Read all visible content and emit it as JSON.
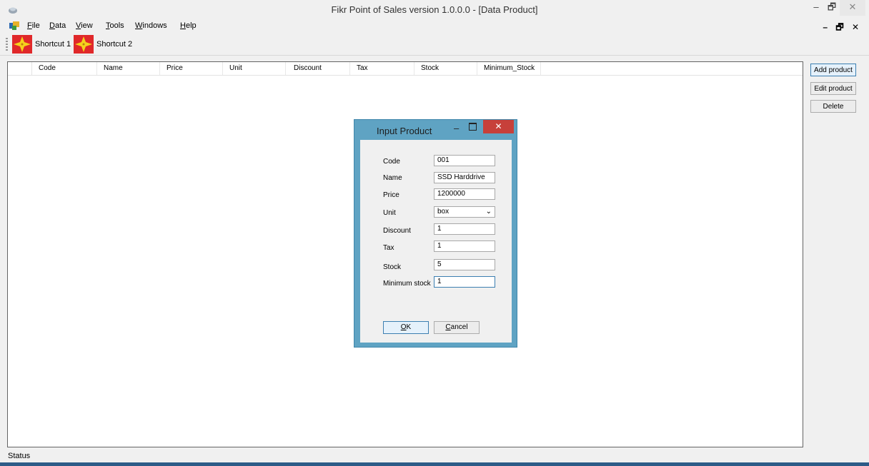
{
  "window": {
    "title": "Fikr Point of Sales version 1.0.0.0 - [Data Product]",
    "app_icon": "app-icon",
    "min": "–",
    "max": "🗗",
    "close": "✕"
  },
  "menu": {
    "items": [
      {
        "hot": "F",
        "rest": "ile"
      },
      {
        "hot": "D",
        "rest": "ata"
      },
      {
        "hot": "V",
        "rest": "iew"
      },
      {
        "hot": "T",
        "rest": "ools"
      },
      {
        "hot": "W",
        "rest": "indows"
      },
      {
        "hot": "H",
        "rest": "elp"
      }
    ],
    "mdi_controls": "– 🗗 ✕"
  },
  "toolbar": {
    "shortcut1": "Shortcut 1",
    "shortcut2": "Shortcut 2",
    "icon_color": "#e0282a"
  },
  "grid": {
    "columns": [
      "Code",
      "Name",
      "Price",
      "Unit",
      "Discount",
      "Tax",
      "Stock",
      "Minimum_Stock"
    ]
  },
  "side_buttons": {
    "add": "Add product",
    "edit": "Edit product",
    "delete": "Delete"
  },
  "status": {
    "text": "Status"
  },
  "dialog": {
    "title": "Input Product",
    "min": "–",
    "close": "✕",
    "fields": {
      "code": {
        "label": "Code",
        "value": "001"
      },
      "name": {
        "label": "Name",
        "value": "SSD Harddrive"
      },
      "price": {
        "label": "Price",
        "value": "1200000"
      },
      "unit": {
        "label": "Unit",
        "value": "box"
      },
      "discount": {
        "label": "Discount",
        "value": "1"
      },
      "tax": {
        "label": "Tax",
        "value": "1"
      },
      "stock": {
        "label": "Stock",
        "value": "5"
      },
      "min_stock": {
        "label": "Minimum stock",
        "value": "1"
      }
    },
    "ok_hot": "O",
    "ok_rest": "K",
    "cancel_hot": "C",
    "cancel_rest": "ancel"
  }
}
